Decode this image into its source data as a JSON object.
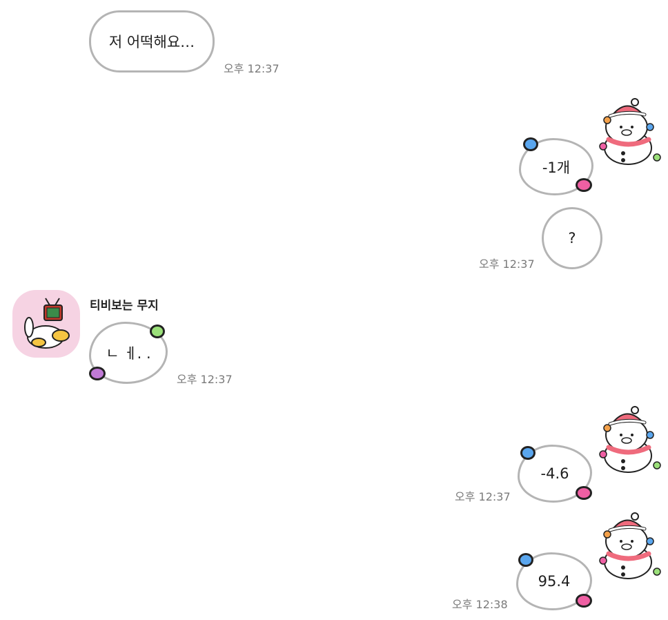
{
  "chat": {
    "messages": [
      {
        "side": "left",
        "text": "저 어떡해요…",
        "time": "오후 12:37"
      },
      {
        "side": "right",
        "text": "-1개"
      },
      {
        "side": "right",
        "text": "?",
        "time": "오후 12:37"
      },
      {
        "side": "left",
        "sender": "티비보는 무지",
        "text": "ㄴ ㅔ. .",
        "time": "오후 12:37"
      },
      {
        "side": "right",
        "text": "-4.6",
        "time": "오후 12:37"
      },
      {
        "side": "right",
        "text": "95.4",
        "time": "오후 12:38"
      }
    ]
  },
  "icons": {
    "avatar": "muzi-watching-tv-avatar",
    "sticker": "snowman-sticker-icon"
  },
  "colors": {
    "bubble_border": "#b4b4b4",
    "avatar_bg": "#f6d3e3",
    "dot_blue": "#5aa6ee",
    "dot_pink": "#ef5fa3",
    "dot_green": "#9be07a",
    "dot_purple": "#c07ad6",
    "timestamp": "#7a7a7a"
  }
}
